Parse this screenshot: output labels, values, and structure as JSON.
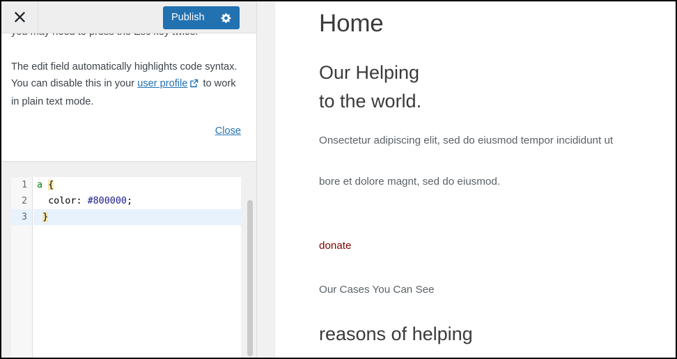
{
  "customizer": {
    "close_button_icon": "close-x-icon",
    "publish": {
      "label": "Publish",
      "icon": "gear-icon",
      "color": "#2271b1"
    },
    "notice": {
      "line1": "you may need to press the Esc key twice.",
      "para2_before": "The edit field automatically highlights code syntax. You can disable this in your ",
      "link_text": "user profile",
      "link_icon": "external-link-icon",
      "para2_after": " to work in plain text mode.",
      "close_label": "Close"
    },
    "editor": {
      "language": "css",
      "line_numbers": [
        "1",
        "2",
        "3"
      ],
      "active_line": 3,
      "lines": [
        [
          {
            "text": "a ",
            "type": "selector"
          },
          {
            "text": "{",
            "type": "brace"
          }
        ],
        [
          {
            "text": "  color",
            "type": "property"
          },
          {
            "text": ": ",
            "type": "punctuation"
          },
          {
            "text": "#800000",
            "type": "value"
          },
          {
            "text": ";",
            "type": "punctuation"
          }
        ],
        [
          {
            "text": " ",
            "type": "punctuation"
          },
          {
            "text": "}",
            "type": "brace"
          }
        ]
      ],
      "css_color_value": "#800000"
    },
    "scrollbar": {
      "name": "editor-vertical-scrollbar"
    }
  },
  "preview": {
    "site_title": "Home",
    "hero_heading": "Our Helping\nto the world.",
    "paragraph_1": "Onsectetur adipiscing elit, sed do eiusmod tempor incididunt ut",
    "paragraph_2": "bore et dolore magnt, sed do eiusmod.",
    "donate_link": "donate",
    "donate_link_color": "#800000",
    "cases_text": "Our Cases You Can See",
    "section_heading": "reasons of helping"
  }
}
